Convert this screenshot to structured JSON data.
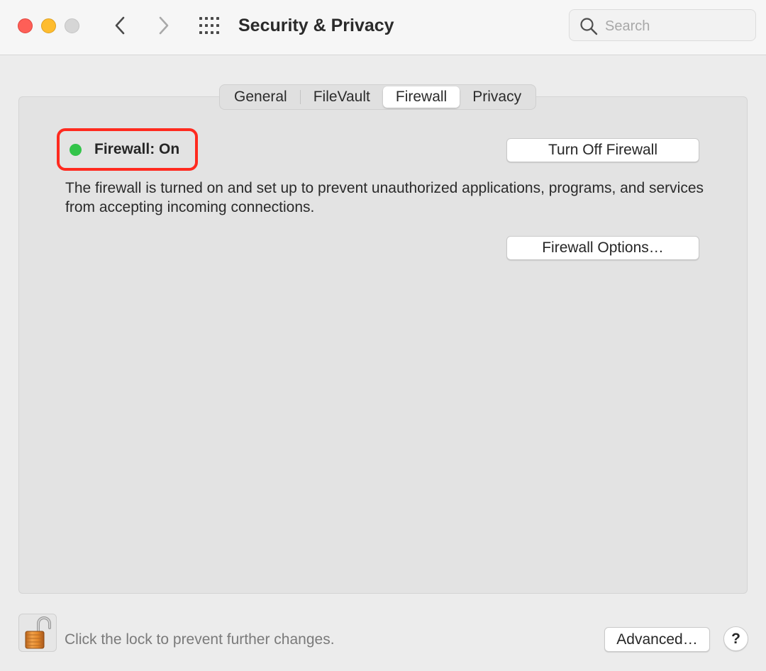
{
  "window": {
    "title": "Security & Privacy",
    "traffic_lights": {
      "close": "#fe5f57",
      "minimize": "#febc2e",
      "zoom": "#d6d6d6"
    }
  },
  "toolbar": {
    "back_icon": "chevron-left-icon",
    "forward_icon": "chevron-right-icon",
    "grid_icon": "show-all-grid-icon"
  },
  "search": {
    "placeholder": "Search",
    "value": "",
    "icon": "magnifying-glass-icon"
  },
  "tabs": [
    {
      "label": "General",
      "selected": false
    },
    {
      "label": "FileVault",
      "selected": false
    },
    {
      "label": "Firewall",
      "selected": true
    },
    {
      "label": "Privacy",
      "selected": false
    }
  ],
  "firewall": {
    "status_label": "Firewall: On",
    "status_color": "#33c44a",
    "highlight_color": "#ff2a1f",
    "turn_off_label": "Turn Off Firewall",
    "description": "The firewall is turned on and set up to prevent unauthorized applications, programs, and services from accepting incoming connections.",
    "options_label": "Firewall Options…"
  },
  "footer": {
    "lock_icon": "unlocked-padlock-icon",
    "lock_text": "Click the lock to prevent further changes.",
    "advanced_label": "Advanced…",
    "help_label": "?"
  }
}
